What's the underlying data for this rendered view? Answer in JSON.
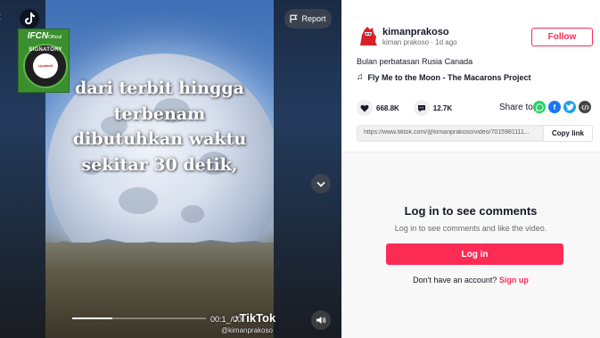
{
  "video": {
    "overlay_lines": [
      "dari terbit hingga",
      "terbenam",
      "dibutuhkan waktu",
      "sekitar 30 detik,"
    ],
    "watermark_brand": "TikTok",
    "watermark_user": "@kimanprakoso",
    "timestamp": "00:1_/00:",
    "progress": 0.3,
    "report_label": "Report",
    "back_icon": "back-arrow-icon",
    "down_icon": "chevron-down-icon",
    "volume_icon": "speaker-icon"
  },
  "ifcn_badge": {
    "brand": "IFCN",
    "brand_suffix": "Official",
    "signatory": "SIGNATORY",
    "org": "Liputan6"
  },
  "author": {
    "username": "kimanprakoso",
    "display_meta": "kiman prakoso · 1d ago",
    "follow_label": "Follow"
  },
  "post": {
    "caption": "Bulan perbatasan Rusia Canada",
    "music": "Fly Me to the Moon - The Macarons Project",
    "likes": "668.8K",
    "comments": "12.7K",
    "share_label": "Share to",
    "link": "https://www.tiktok.com/@kimanprakoso/video/7015981111...",
    "copy_label": "Copy link"
  },
  "comments_panel": {
    "title": "Log in to see comments",
    "subtitle": "Log in to see comments and like the video.",
    "login_label": "Log in",
    "signup_prompt": "Don't have an account?",
    "signup_label": "Sign up"
  },
  "colors": {
    "accent": "#fe2c55",
    "whatsapp": "#25d366",
    "facebook": "#1877f2",
    "twitter": "#1da1f2",
    "embed": "#444444"
  }
}
